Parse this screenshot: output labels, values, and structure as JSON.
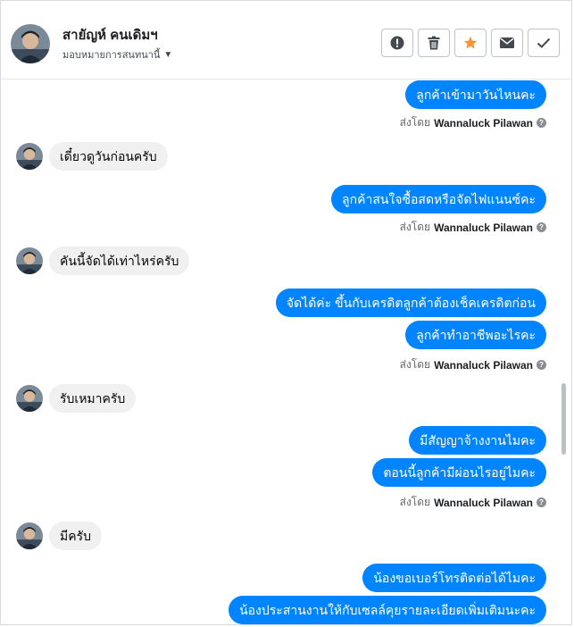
{
  "header": {
    "contact_name": "สายัญห์ คนเดิมฯ",
    "assign_label": "มอบหมายการสนทนานี้",
    "actions": {
      "report": "report-icon",
      "delete": "trash-icon",
      "star": "star-icon",
      "mail": "mail-icon",
      "done": "check-icon"
    }
  },
  "thread": {
    "sent_by_prefix": "ส่งโดย",
    "agent_name": "Wannaluck Pilawan",
    "messages": [
      {
        "dir": "out",
        "text": "ลูกค้าเข้ามาวันไหนคะ"
      },
      {
        "dir": "in",
        "text": "เดี๋ยวดูวันก่อนครับ"
      },
      {
        "dir": "out",
        "text": "ลูกค้าสนใจซื้อสดหรือจัดไฟแนนซ์คะ"
      },
      {
        "dir": "in",
        "text": "คันนี้จัดได้เท่าไหร่ครับ"
      },
      {
        "dir": "out",
        "text": "จัดได้ค่ะ ขึ้นกับเครดิตลูกค้าต้องเช็คเครดิตก่อน"
      },
      {
        "dir": "out",
        "text": "ลูกค้าทำอาชีพอะไรคะ"
      },
      {
        "dir": "in",
        "text": "รับเหมาครับ"
      },
      {
        "dir": "out",
        "text": "มีสัญญาจ้างงานไมคะ"
      },
      {
        "dir": "out",
        "text": "ตอนนี้ลูกค้ามีผ่อนไรอยู่ไมคะ"
      },
      {
        "dir": "in",
        "text": "มีครับ"
      },
      {
        "dir": "out",
        "text": "น้องขอเบอร์โทรติดต่อได้ไมคะ"
      },
      {
        "dir": "out",
        "text": "น้องประสานงานให้กับเซลล์คุยรายละเอียดเพิ่มเติมนะคะ"
      }
    ]
  },
  "colors": {
    "outgoing_bubble": "#0084ff",
    "incoming_bubble": "#f0f0f0",
    "star": "#f7923b"
  }
}
